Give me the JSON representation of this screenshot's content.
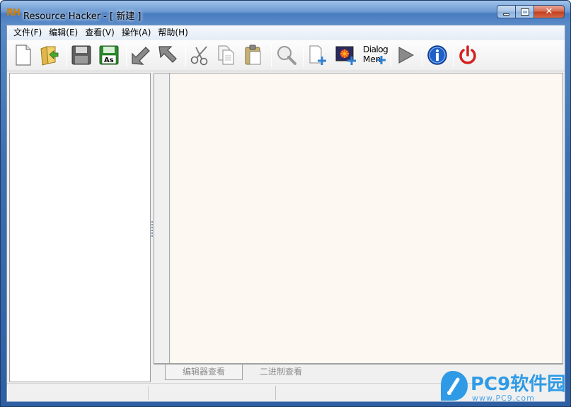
{
  "window": {
    "app_icon_text": "RH",
    "title": "Resource Hacker - [ 新建 ]"
  },
  "menubar": {
    "items": [
      {
        "label": "文件(F)"
      },
      {
        "label": "编辑(E)"
      },
      {
        "label": "查看(V)"
      },
      {
        "label": "操作(A)"
      },
      {
        "label": "帮助(H)"
      }
    ]
  },
  "toolbar": {
    "buttons": [
      {
        "icon": "new-file-icon"
      },
      {
        "icon": "open-folder-icon"
      },
      {
        "icon": "save-icon"
      },
      {
        "icon": "save-as-icon",
        "label": "As"
      },
      {
        "icon": "compile-left-icon"
      },
      {
        "icon": "compile-right-icon"
      },
      {
        "icon": "cut-icon"
      },
      {
        "icon": "copy-icon"
      },
      {
        "icon": "paste-icon"
      },
      {
        "icon": "search-icon"
      },
      {
        "icon": "add-resource-icon"
      },
      {
        "icon": "add-image-icon"
      },
      {
        "icon": "dialog-menu-icon",
        "label_top": "Dialog",
        "label_bottom": "Men"
      },
      {
        "icon": "play-icon"
      },
      {
        "icon": "info-icon"
      },
      {
        "icon": "power-icon"
      }
    ]
  },
  "tabs": [
    {
      "label": "编辑器查看",
      "active": true
    },
    {
      "label": "二进制查看",
      "active": false
    }
  ],
  "watermark": {
    "text": "PC9软件园",
    "url": "www.PC9.com"
  },
  "colors": {
    "editor_bg": "#fef8f2",
    "accent": "#2f9be6",
    "power_red": "#d42020",
    "info_blue": "#1f5fc8"
  }
}
